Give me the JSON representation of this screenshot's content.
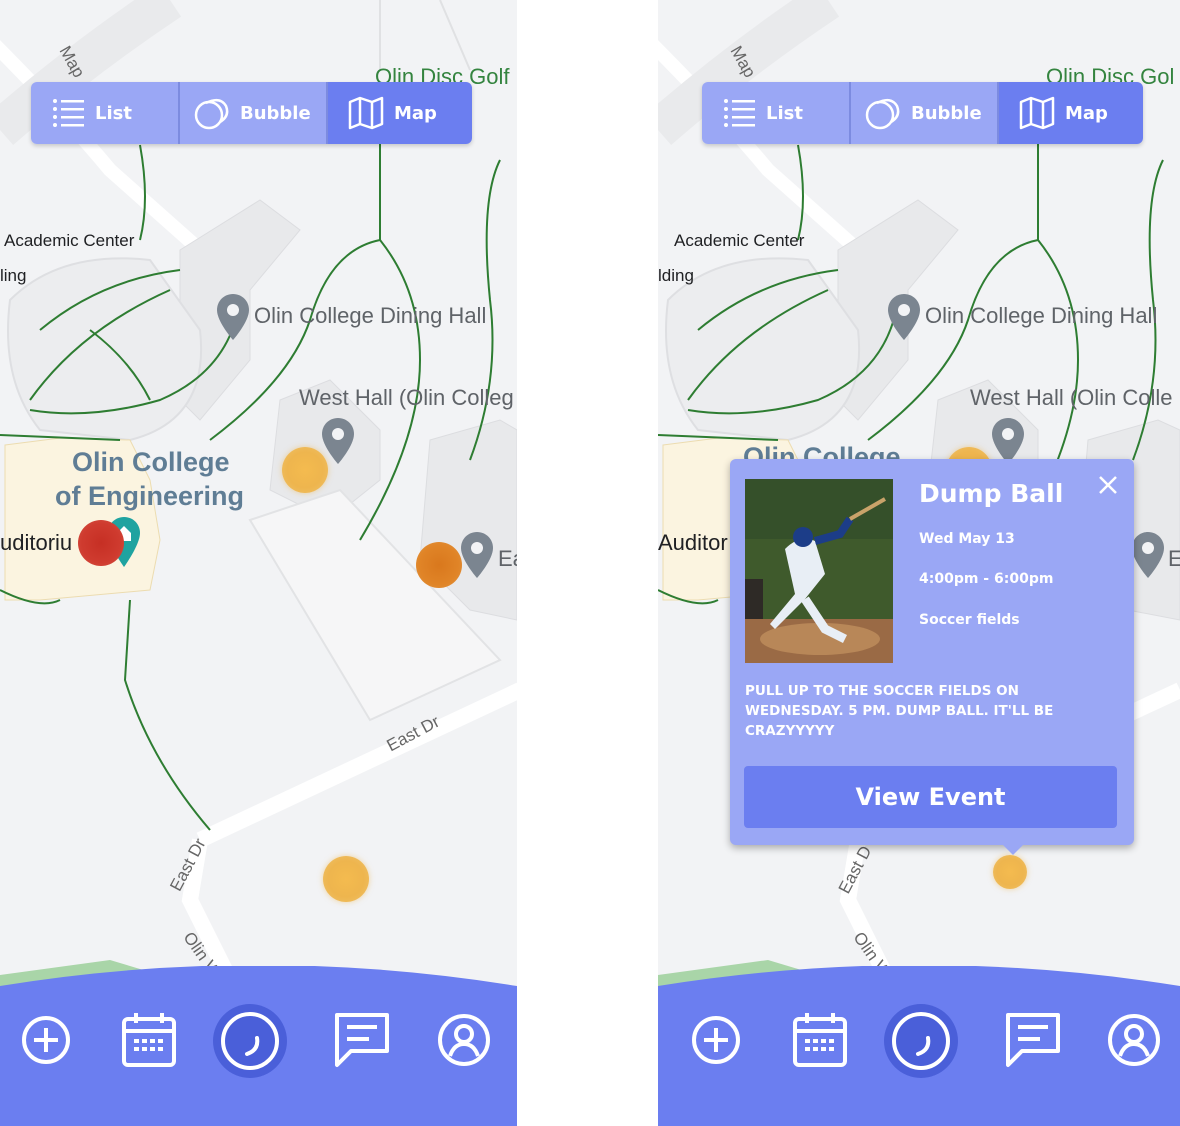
{
  "view_toggle": {
    "list_label": "List",
    "bubble_label": "Bubble",
    "map_label": "Map",
    "active": "Map"
  },
  "map": {
    "labels": {
      "academic_center": "Academic Center",
      "building_left": "ling",
      "building_right": "lding",
      "dining_hall": "Olin College Dining Hall",
      "west_hall_left": "West Hall (Olin Colleg",
      "west_hall_right": "West Hall (Olin Colle",
      "college_line1": "Olin College",
      "college_line2": "of Engineering",
      "college_partial": "Olin College",
      "auditorium_left": "uditoriu",
      "auditorium_right": "Auditor",
      "east_partial_left": "Ea",
      "east_partial_right": "E",
      "disc_golf_left": "Olin Disc Golf",
      "disc_golf_right": "Olin Disc Gol",
      "east_dr_1": "East Dr",
      "east_dr_2": "East Dr",
      "east_dr_right": "East D",
      "olin_way": "Olin W",
      "olin_way_right": "Olin W",
      "map_road": "Map"
    }
  },
  "event_popup": {
    "title": "Dump Ball",
    "date": "Wed May 13",
    "time": "4:00pm - 6:00pm",
    "location": "Soccer fields",
    "description": "PULL UP TO THE SOCCER FIELDS ON WEDNESDAY. 5 PM. DUMP BALL. IT'LL BE CRAZYYYYY",
    "button_label": "View Event"
  },
  "bottom_nav": {
    "items": [
      "add-icon",
      "calendar-icon",
      "bubble-home-icon",
      "chat-icon",
      "profile-icon"
    ]
  },
  "colors": {
    "accent": "#6b7ef0",
    "accent_light": "#9aa7f5",
    "map_bg": "#f2f3f5",
    "path_green": "#2e7d32",
    "event_yellow": "#eeb54e",
    "event_orange": "#e08427",
    "event_red": "#cf3b2f"
  }
}
